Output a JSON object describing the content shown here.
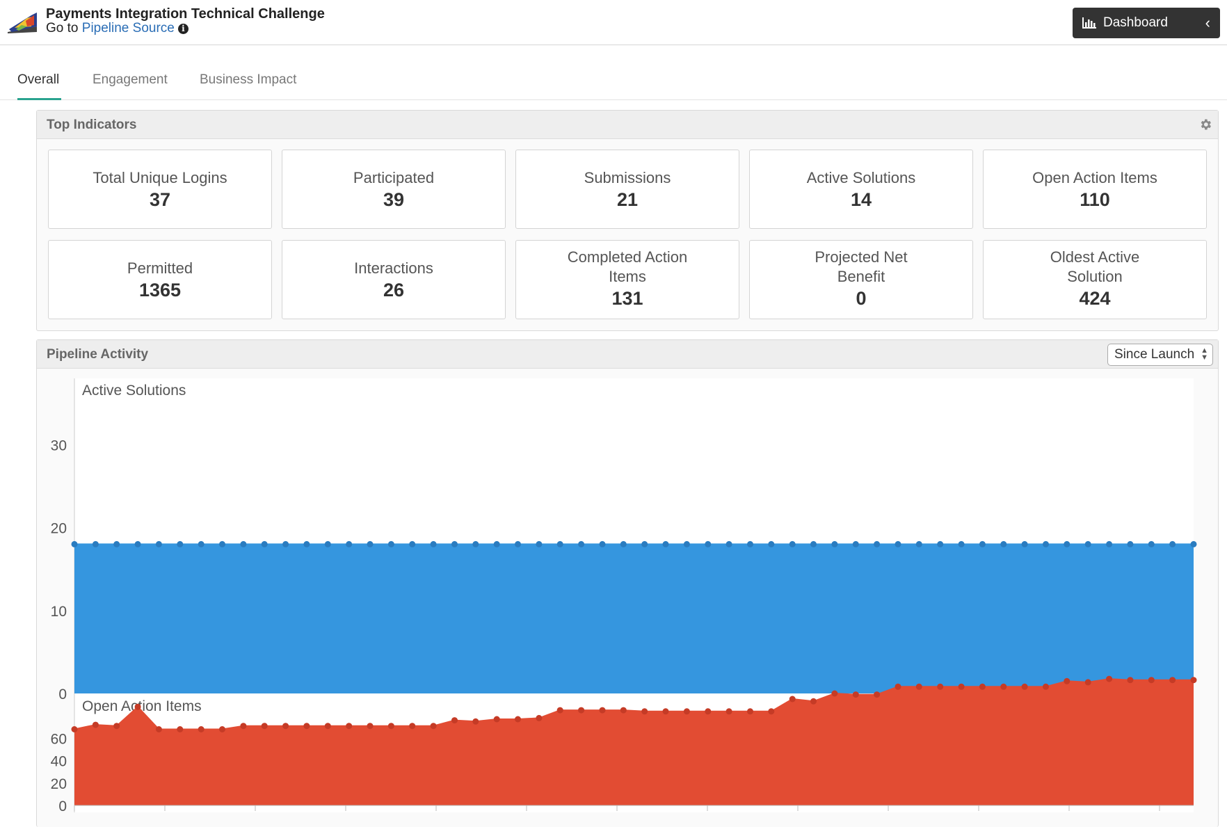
{
  "header": {
    "title": "Payments Integration Technical Challenge",
    "subtitle_prefix": "Go to",
    "subtitle_link": "Pipeline Source",
    "info_icon": "info-circle-icon",
    "dashboard_label": "Dashboard",
    "dashboard_icon": "bar-chart-icon",
    "chevron_icon": "chevron-left-icon"
  },
  "tabs": [
    {
      "label": "Overall",
      "active": true
    },
    {
      "label": "Engagement",
      "active": false
    },
    {
      "label": "Business Impact",
      "active": false
    }
  ],
  "top_indicators": {
    "title": "Top Indicators",
    "settings_icon": "gear-icon",
    "cards": [
      {
        "label": "Total Unique Logins",
        "value": "37"
      },
      {
        "label": "Participated",
        "value": "39"
      },
      {
        "label": "Submissions",
        "value": "21"
      },
      {
        "label": "Active Solutions",
        "value": "14"
      },
      {
        "label": "Open Action Items",
        "value": "110"
      },
      {
        "label": "Permitted",
        "value": "1365"
      },
      {
        "label": "Interactions",
        "value": "26"
      },
      {
        "label": "Completed Action Items",
        "value": "131"
      },
      {
        "label": "Projected Net Benefit",
        "value": "0"
      },
      {
        "label": "Oldest Active Solution",
        "value": "424"
      }
    ]
  },
  "pipeline_activity": {
    "title": "Pipeline Activity",
    "range_select": "Since Launch"
  },
  "colors": {
    "accent_tab": "#2aa38f",
    "active_solutions": "#3596df",
    "open_action_items": "#e24c33",
    "link": "#2a6db5"
  },
  "chart_data": [
    {
      "type": "area",
      "title": "Active Solutions",
      "ylim": [
        0,
        38
      ],
      "yticks": [
        "0",
        "10",
        "20",
        "30"
      ],
      "series": [
        {
          "name": "Active Solutions",
          "values": [
            18,
            18,
            18,
            18,
            18,
            18,
            18,
            18,
            18,
            18,
            18,
            18,
            18,
            18,
            18,
            18,
            18,
            18,
            18,
            18,
            18,
            18,
            18,
            18,
            18,
            18,
            18,
            18,
            18,
            18,
            18,
            18,
            18,
            18,
            18,
            18,
            18,
            18,
            18,
            18,
            18,
            18,
            18,
            18,
            18,
            18,
            18,
            18,
            18,
            18,
            18,
            18,
            18,
            18
          ]
        }
      ]
    },
    {
      "type": "area",
      "title": "Open Action Items",
      "ylim": [
        0,
        100
      ],
      "yticks": [
        "0",
        "20",
        "40",
        "60"
      ],
      "series": [
        {
          "name": "Open Action Items",
          "values": [
            68,
            72,
            71,
            88,
            68,
            68,
            68,
            68,
            71,
            71,
            71,
            71,
            71,
            71,
            71,
            71,
            71,
            71,
            76,
            75,
            77,
            77,
            78,
            85,
            85,
            85,
            85,
            84,
            84,
            84,
            84,
            84,
            84,
            84,
            95,
            93,
            100,
            99,
            99,
            106,
            106,
            106,
            106,
            106,
            106,
            106,
            106,
            111,
            110,
            113,
            112,
            112,
            112,
            112
          ]
        }
      ]
    }
  ]
}
